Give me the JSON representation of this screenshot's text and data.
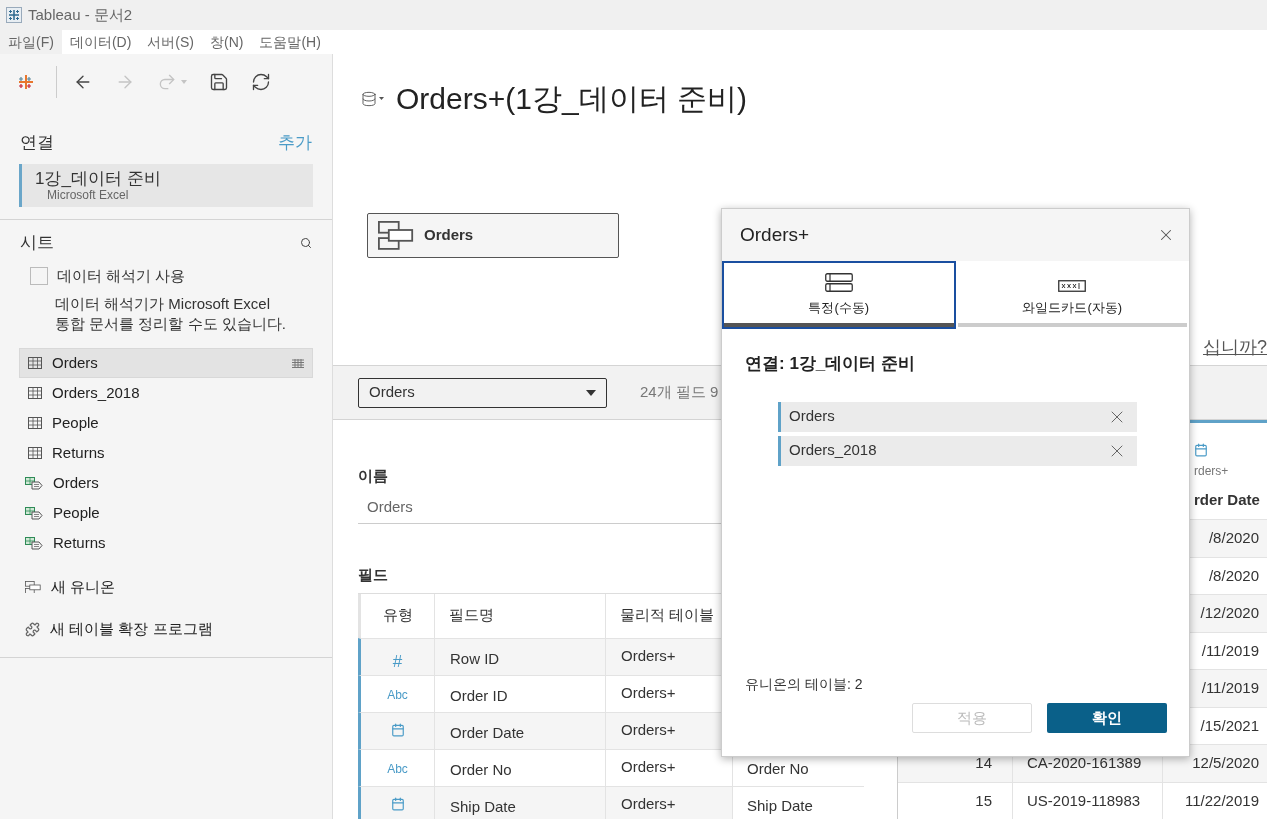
{
  "window": {
    "title": "Tableau - 문서2"
  },
  "menu": [
    {
      "label": "파일(F)",
      "selected": true
    },
    {
      "label": "데이터(D)",
      "selected": false
    },
    {
      "label": "서버(S)",
      "selected": false
    },
    {
      "label": "창(N)",
      "selected": false
    },
    {
      "label": "도움말(H)",
      "selected": false
    }
  ],
  "toolbar": [
    {
      "kind": "back",
      "disabled": false
    },
    {
      "kind": "forward",
      "disabled": true
    },
    {
      "kind": "redo",
      "disabled": true
    },
    {
      "kind": "save",
      "disabled": false
    },
    {
      "kind": "refresh",
      "disabled": false
    }
  ],
  "connections": {
    "title": "연결",
    "add": "추가",
    "items": [
      {
        "name": "1강_데이터 준비",
        "type": "Microsoft Excel",
        "selected": true
      }
    ]
  },
  "sheets": {
    "title": "시트",
    "interpreter": {
      "label": "데이터 해석기 사용",
      "checked": false,
      "description": "데이터 해석기가 Microsoft Excel\n통합 문서를 정리할 수도 있습니다."
    },
    "items": [
      {
        "name": "Orders",
        "kind": "table",
        "selected": true
      },
      {
        "name": "Orders_2018",
        "kind": "table",
        "selected": false
      },
      {
        "name": "People",
        "kind": "table",
        "selected": false
      },
      {
        "name": "Returns",
        "kind": "table",
        "selected": false
      },
      {
        "name": "Orders",
        "kind": "range",
        "selected": false
      },
      {
        "name": "People",
        "kind": "range",
        "selected": false
      },
      {
        "name": "Returns",
        "kind": "range",
        "selected": false
      }
    ],
    "actions": [
      {
        "label": "새 유니온",
        "kind": "union"
      },
      {
        "label": "새 테이블 확장 프로그램",
        "kind": "extension"
      }
    ]
  },
  "canvas": {
    "title": "Orders+(1강_데이터 준비)",
    "nodes": [
      {
        "label": "Orders"
      }
    ],
    "hint": "십니까?"
  },
  "details": {
    "table_select": "Orders",
    "field_count": "24개 필드 9",
    "name_label": "이름",
    "name_value": "Orders",
    "fields_label": "필드",
    "columns": [
      "유형",
      "필드명",
      "물리적 테이블"
    ],
    "rows": [
      {
        "kind": "number",
        "type_text": "#",
        "field": "Row ID",
        "table": "Orders+"
      },
      {
        "kind": "string",
        "type_text": "Abc",
        "field": "Order ID",
        "table": "Orders+"
      },
      {
        "kind": "date",
        "field": "Order Date",
        "table": "Orders+"
      },
      {
        "kind": "string",
        "type_text": "Abc",
        "field": "Order No",
        "table": "Orders+",
        "column_4": "Order No"
      },
      {
        "kind": "date",
        "field": "Ship Date",
        "table": "Orders+",
        "column_4": "Ship Date"
      }
    ]
  },
  "grid": {
    "header": {
      "source": "rders+",
      "column": "rder Date"
    },
    "rows": [
      {
        "column_3": "/8/2020"
      },
      {
        "column_3": "/8/2020"
      },
      {
        "column_3": "/12/2020"
      },
      {
        "column_3": "/11/2019"
      },
      {
        "column_3": "/11/2019"
      },
      {
        "column_3": "/15/2021"
      },
      {
        "column_1": "14",
        "column_2": "CA-2020-161389",
        "column_3": "12/5/2020"
      },
      {
        "column_1": "15",
        "column_2": "US-2019-118983",
        "column_3": "11/22/2019"
      }
    ]
  },
  "dialog": {
    "title": "Orders+",
    "tabs": [
      {
        "label": "특정(수동)",
        "kind": "manual",
        "selected": true
      },
      {
        "label": "와일드카드(자동)",
        "kind": "wildcard",
        "selected": false
      }
    ],
    "connection": "연결: 1강_데이터 준비",
    "tables": [
      "Orders",
      "Orders_2018"
    ],
    "count": "유니온의 테이블: 2",
    "buttons": [
      {
        "label": "적용",
        "kind": "secondary",
        "disabled": true
      },
      {
        "label": "확인",
        "kind": "primary",
        "disabled": false
      }
    ]
  }
}
